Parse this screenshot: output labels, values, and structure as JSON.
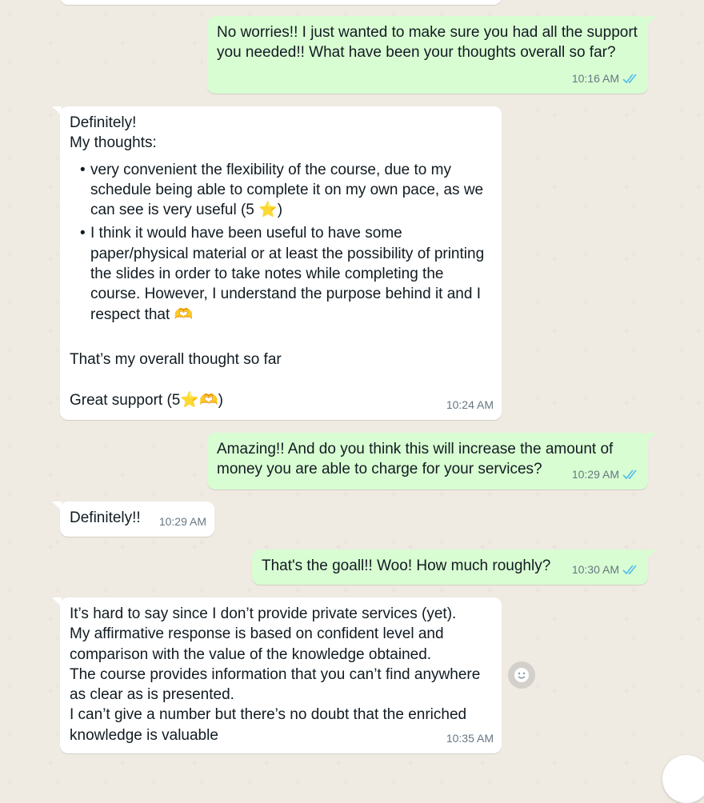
{
  "messages": [
    {
      "id": "m1",
      "dir": "out",
      "text": "No worries!! I just wanted to make sure you had all the support you needed!! What have been your thoughts overall so far?",
      "time": "10:16 AM",
      "status": "read"
    },
    {
      "id": "m2",
      "dir": "in",
      "intro": "Definitely!\nMy thoughts:",
      "bullets": [
        "very convenient the flexibility of the course, due to my schedule being able to complete it on my own pace, as we can see is very useful (5 ⭐)",
        "I think it would have been useful to have some paper/physical material or at least the possibility of printing the slides in order to take notes while completing the course. However, I understand the purpose behind it and I respect that 🫶"
      ],
      "outro": "That’s my overall thought so far\n\nGreat support (5⭐🫶)",
      "time": "10:24 AM"
    },
    {
      "id": "m3",
      "dir": "out",
      "text": "Amazing!! And do you think this will increase the amount of money you are able to charge for your services?",
      "time": "10:29 AM",
      "status": "read"
    },
    {
      "id": "m4",
      "dir": "in",
      "text": "Definitely!!",
      "time": "10:29 AM"
    },
    {
      "id": "m5",
      "dir": "out",
      "text": "That's the goall!! Woo! How much roughly?",
      "time": "10:30 AM",
      "status": "read"
    },
    {
      "id": "m6",
      "dir": "in",
      "text": "It’s hard to say since I don’t provide private services (yet).\nMy affirmative response is based on confident level and comparison with the value of the knowledge obtained.\nThe course provides information that you can’t find anywhere as clear as is presented.\nI can’t give a number but there’s no doubt that the enriched knowledge is valuable",
      "time": "10:35 AM"
    }
  ],
  "bullet_char": "•",
  "colors": {
    "incoming": "#ffffff",
    "outgoing": "#d9fdd3",
    "read_ticks": "#53bdeb",
    "meta": "#667781",
    "background": "#efeae2"
  },
  "icons": {
    "read_receipt": "double-check-icon",
    "reaction": "smiley-icon"
  }
}
